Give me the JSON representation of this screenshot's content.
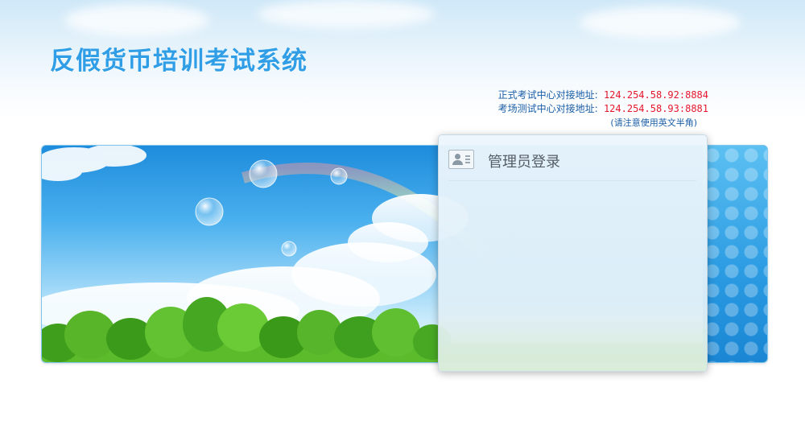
{
  "header": {
    "title": "反假货币培训考试系统"
  },
  "server_info": {
    "rows": [
      {
        "label": "正式考试中心对接地址:",
        "address": "124.254.58.92:8884"
      },
      {
        "label": "考场测试中心对接地址:",
        "address": "124.254.58.93:8881"
      }
    ],
    "note": "(请注意使用英文半角)"
  },
  "login": {
    "title": "管理员登录",
    "icon": "user-card-icon"
  },
  "colors": {
    "title": "#2f9ee6",
    "label": "#1a5ea6",
    "address": "#e5162b"
  }
}
